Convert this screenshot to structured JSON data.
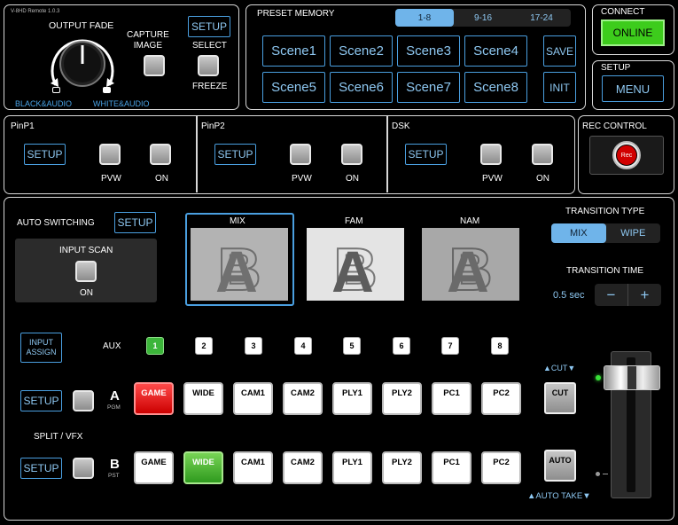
{
  "version": "V-8HD Remote 1.0.3",
  "fade": {
    "title": "OUTPUT FADE",
    "black_label": "BLACK&AUDIO",
    "white_label": "WHITE&AUDIO",
    "capture_label": "CAPTURE\nIMAGE",
    "setup_label": "SETUP",
    "select_label": "SELECT",
    "freeze_label": "FREEZE"
  },
  "preset": {
    "title": "PRESET MEMORY",
    "tabs": [
      "1-8",
      "9-16",
      "17-24"
    ],
    "scenes": [
      "Scene1",
      "Scene2",
      "Scene3",
      "Scene4",
      "Scene5",
      "Scene6",
      "Scene7",
      "Scene8"
    ],
    "save_label": "SAVE",
    "init_label": "INIT"
  },
  "connect": {
    "title": "CONNECT",
    "button": "ONLINE"
  },
  "setup_panel": {
    "title": "SETUP",
    "button": "MENU"
  },
  "pinp1": {
    "title": "PinP1",
    "setup": "SETUP",
    "pvw": "PVW",
    "on": "ON"
  },
  "pinp2": {
    "title": "PinP2",
    "setup": "SETUP",
    "pvw": "PVW",
    "on": "ON"
  },
  "dsk": {
    "title": "DSK",
    "setup": "SETUP",
    "pvw": "PVW",
    "on": "ON"
  },
  "rec": {
    "title": "REC CONTROL",
    "button": "Rec"
  },
  "auto_switching": {
    "title": "AUTO SWITCHING",
    "setup": "SETUP",
    "input_scan": "INPUT SCAN",
    "on": "ON"
  },
  "transitions": {
    "effects": [
      "MIX",
      "FAM",
      "NAM"
    ],
    "type_title": "TRANSITION TYPE",
    "types": [
      "MIX",
      "WIPE"
    ],
    "time_title": "TRANSITION TIME",
    "time_value": "0.5 sec",
    "minus": "−",
    "plus": "+"
  },
  "switcher": {
    "input_assign": "INPUT\nASSIGN",
    "aux_label": "AUX",
    "aux": [
      "1",
      "2",
      "3",
      "4",
      "5",
      "6",
      "7",
      "8"
    ],
    "a_label": "A",
    "pgm_label": "PGM",
    "b_label": "B",
    "pst_label": "PST",
    "sources": [
      "GAME",
      "WIDE",
      "CAM1",
      "CAM2",
      "PLY1",
      "PLY2",
      "PC1",
      "PC2"
    ],
    "setup": "SETUP",
    "split_label": "SPLIT / VFX",
    "cut_title": "▲CUT▼",
    "cut": "CUT",
    "auto": "AUTO",
    "auto_take": "▲AUTO TAKE▼"
  },
  "colors": {
    "accent": "#4a9fe0",
    "pgm_red": "#e01010",
    "pst_green": "#3aa22a",
    "online_green": "#3dcc1c"
  }
}
